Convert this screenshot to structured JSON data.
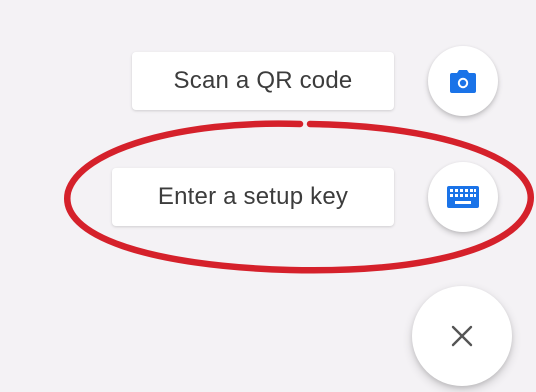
{
  "speed_dial": {
    "scan_qr": {
      "label": "Scan a QR code",
      "icon": "camera-icon"
    },
    "setup_key": {
      "label": "Enter a setup key",
      "icon": "keyboard-icon"
    },
    "close": {
      "icon": "close-icon"
    }
  },
  "colors": {
    "accent": "#1a73e8",
    "annotation": "#d5212b",
    "background": "#f4f2f5"
  }
}
